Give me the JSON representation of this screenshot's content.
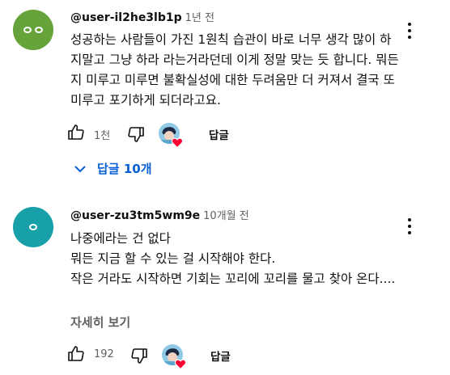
{
  "comments": [
    {
      "author": "@user-il2he3lb1p",
      "time": "1년 전",
      "avatar_color": "#66a33a",
      "text": "성공하는 사람들이 가진 1원칙 습관이 바로 너무 생각 많이 하지말고 그냥 하라 라는거라던데 이게 정말 맞는 듯 합니다. 뭐든지 미루고 미루면 불확실성에 대한 두려움만 더 커져서 결국 또 미루고 포기하게 되더라고요.",
      "likes": "1천",
      "reply_label": "답글",
      "replies_toggle": "답글 10개"
    },
    {
      "author": "@user-zu3tm5wm9e",
      "time": "10개월 전",
      "avatar_color": "#17a0a8",
      "lines": [
        "나중에라는 건 없다",
        "뭐든 지금 할 수 있는 걸 시작해야 한다.",
        "작은 거라도 시작하면 기회는 꼬리에 꼬리를 물고 찾아 온다...."
      ],
      "more_label": "자세히 보기",
      "likes": "192",
      "reply_label": "답글"
    }
  ]
}
